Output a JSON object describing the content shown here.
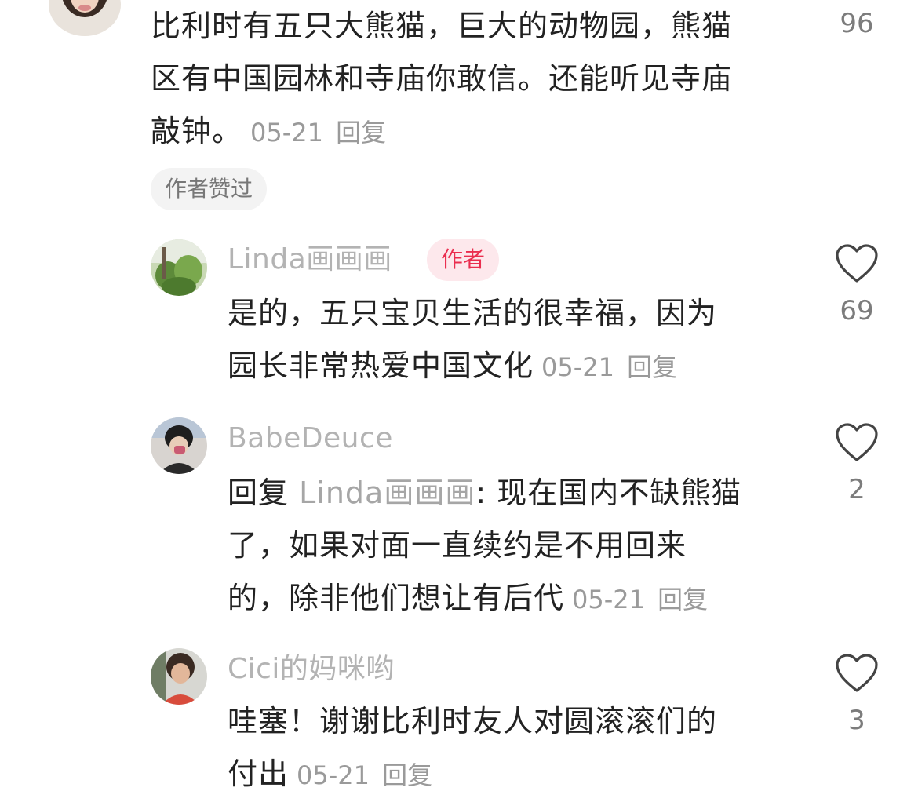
{
  "comments": [
    {
      "text_lines": [
        "比利时有五只大熊猫，巨大的动物园，熊猫",
        "区有中国园林和寺庙你敢信。还能听见寺庙",
        "敲钟。"
      ],
      "date": "05-21",
      "reply_label": "回复",
      "likes": "96",
      "liked_by_author_label": "作者赞过",
      "replies": [
        {
          "username": "Linda画画画",
          "author_tag": "作者",
          "text_lines": [
            "是的，五只宝贝生活的很幸福，因为",
            "园长非常热爱中国文化"
          ],
          "date": "05-21",
          "reply_label": "回复",
          "likes": "69"
        },
        {
          "username": "BabeDeuce",
          "reply_prefix": "回复",
          "reply_to": "Linda画画画",
          "first_line_rest": ": 现在国内不缺熊猫",
          "text_lines": [
            "了，如果对面一直续约是不用回来",
            "的，除非他们想让有后代"
          ],
          "date": "05-21",
          "reply_label": "回复",
          "likes": "2"
        },
        {
          "username": "Cici的妈咪哟",
          "text_lines": [
            "哇塞！谢谢比利时友人对圆滚滚们的",
            "付出"
          ],
          "date": "05-21",
          "reply_label": "回复",
          "likes": "3"
        }
      ]
    }
  ],
  "colors": {
    "username": "#b3b3b3",
    "meta": "#9a9a9a",
    "author_tag_bg": "#fde8ec",
    "author_tag_text": "#ea2e4f",
    "heart_outline": "#444444"
  },
  "icons": [
    "heart-outline-icon"
  ]
}
